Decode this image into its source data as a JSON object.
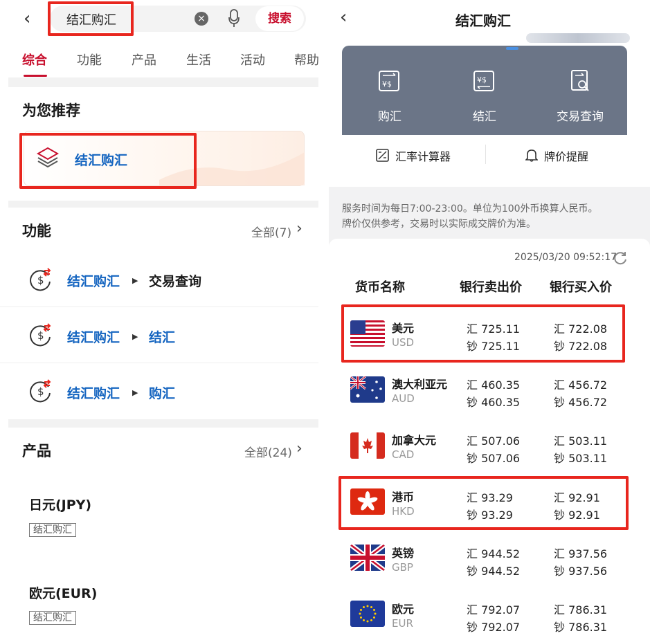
{
  "left": {
    "search": {
      "query": "结汇购汇",
      "clear_glyph": "×",
      "search_button": "搜索"
    },
    "tabs": [
      "综合",
      "功能",
      "产品",
      "生活",
      "活动",
      "帮助"
    ],
    "recommend": {
      "title": "为您推荐",
      "item_label": "结汇购汇"
    },
    "functions": {
      "title": "功能",
      "more": "全部(7)",
      "items": [
        {
          "main": "结汇购汇",
          "sub": "交易查询"
        },
        {
          "main": "结汇购汇",
          "sub": "结汇"
        },
        {
          "main": "结汇购汇",
          "sub": "购汇"
        }
      ]
    },
    "products": {
      "title": "产品",
      "more": "全部(24)",
      "items": [
        {
          "name": "日元(JPY)",
          "tag": "结汇购汇"
        },
        {
          "name": "欧元(EUR)",
          "tag": "结汇购汇"
        }
      ]
    }
  },
  "right": {
    "title": "结汇购汇",
    "operations": [
      "购汇",
      "结汇",
      "交易查询"
    ],
    "tools": [
      "汇率计算器",
      "牌价提醒"
    ],
    "notice_line1": "服务时间为每日7:00-23:00。单位为100外币换算人民币。",
    "notice_line2": "牌价仅供参考，交易时以实际成交牌价为准。",
    "timestamp": "2025/03/20 09:52:17",
    "headers": [
      "货币名称",
      "银行卖出价",
      "银行买入价"
    ],
    "rate_prefix_transfer": "汇",
    "rate_prefix_cash": "钞",
    "currencies": [
      {
        "name": "美元",
        "code": "USD",
        "sell_transfer": "725.11",
        "sell_cash": "725.11",
        "buy_transfer": "722.08",
        "buy_cash": "722.08"
      },
      {
        "name": "澳大利亚元",
        "code": "AUD",
        "sell_transfer": "460.35",
        "sell_cash": "460.35",
        "buy_transfer": "456.72",
        "buy_cash": "456.72"
      },
      {
        "name": "加拿大元",
        "code": "CAD",
        "sell_transfer": "507.06",
        "sell_cash": "507.06",
        "buy_transfer": "503.11",
        "buy_cash": "503.11"
      },
      {
        "name": "港币",
        "code": "HKD",
        "sell_transfer": "93.29",
        "sell_cash": "93.29",
        "buy_transfer": "92.91",
        "buy_cash": "92.91"
      },
      {
        "name": "英镑",
        "code": "GBP",
        "sell_transfer": "944.52",
        "sell_cash": "944.52",
        "buy_transfer": "937.56",
        "buy_cash": "937.56"
      },
      {
        "name": "欧元",
        "code": "EUR",
        "sell_transfer": "792.07",
        "sell_cash": "792.07",
        "buy_transfer": "786.31",
        "buy_cash": "786.31"
      }
    ]
  },
  "colors": {
    "brand_red": "#c8102e",
    "link_blue": "#1565c0",
    "highlight_red": "#e8261e",
    "card_gray": "#6b7587"
  }
}
